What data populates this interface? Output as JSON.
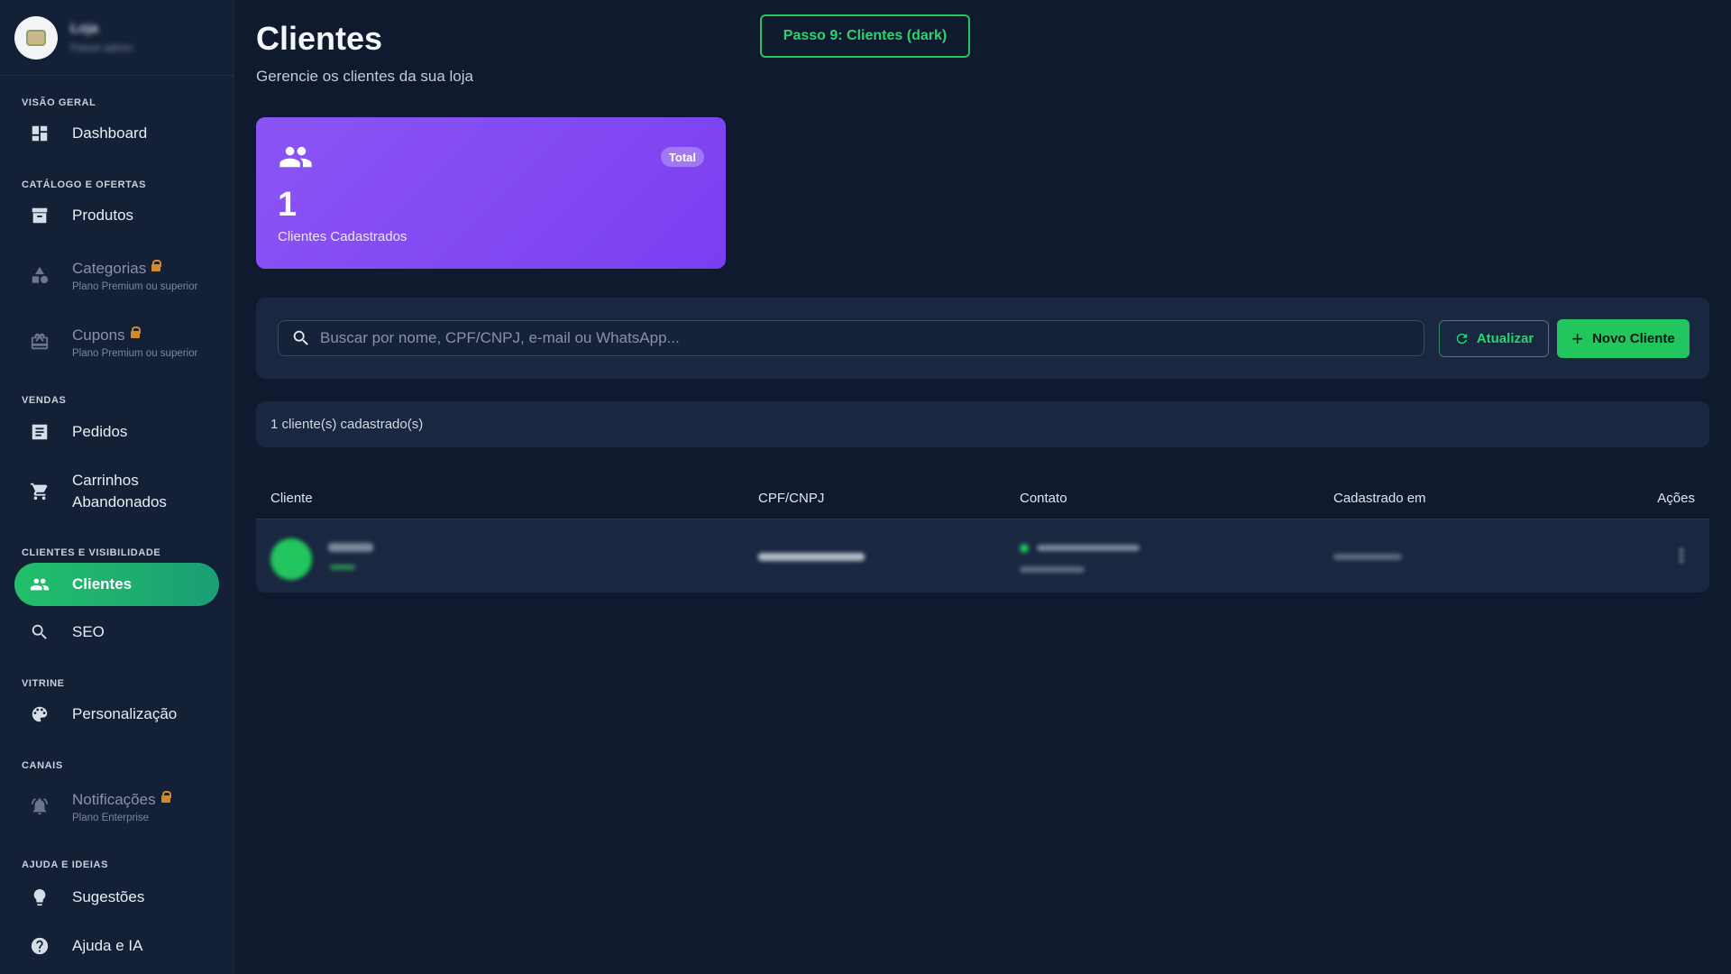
{
  "sidebar": {
    "store_name": "Loja",
    "store_sub": "Painel admin",
    "sections": {
      "visao_geral": "VISÃO GERAL",
      "catalogo": "CATÁLOGO E OFERTAS",
      "vendas": "VENDAS",
      "clientes": "CLIENTES E VISIBILIDADE",
      "vitrine": "VITRINE",
      "canais": "CANAIS",
      "ajuda": "AJUDA E IDEIAS"
    },
    "items": {
      "dashboard": "Dashboard",
      "produtos": "Produtos",
      "categorias": "Categorias",
      "categorias_sub": "Plano Premium ou superior",
      "cupons": "Cupons",
      "cupons_sub": "Plano Premium ou superior",
      "pedidos": "Pedidos",
      "carrinhos_1": "Carrinhos",
      "carrinhos_2": "Abandonados",
      "clientes": "Clientes",
      "seo": "SEO",
      "personalizacao": "Personalização",
      "notificacoes": "Notificações",
      "notificacoes_sub": "Plano Enterprise",
      "sugestoes": "Sugestões",
      "ajuda_ia": "Ajuda e IA"
    }
  },
  "header": {
    "title": "Clientes",
    "subtitle": "Gerencie os clientes da sua loja",
    "step_label": "Passo 9: Clientes (dark)"
  },
  "stat": {
    "badge": "Total",
    "value": "1",
    "label": "Clientes Cadastrados"
  },
  "search": {
    "placeholder": "Buscar por nome, CPF/CNPJ, e-mail ou WhatsApp...",
    "refresh_label": "Atualizar",
    "new_label": "Novo Cliente"
  },
  "count_text": "1 cliente(s) cadastrado(s)",
  "table": {
    "columns": [
      "Cliente",
      "CPF/CNPJ",
      "Contato",
      "Cadastrado em",
      "Ações"
    ]
  },
  "colors": {
    "accent": "#22c55e",
    "card": "#8b55f5",
    "background": "#0f1a2e",
    "panel": "#1a2740"
  }
}
